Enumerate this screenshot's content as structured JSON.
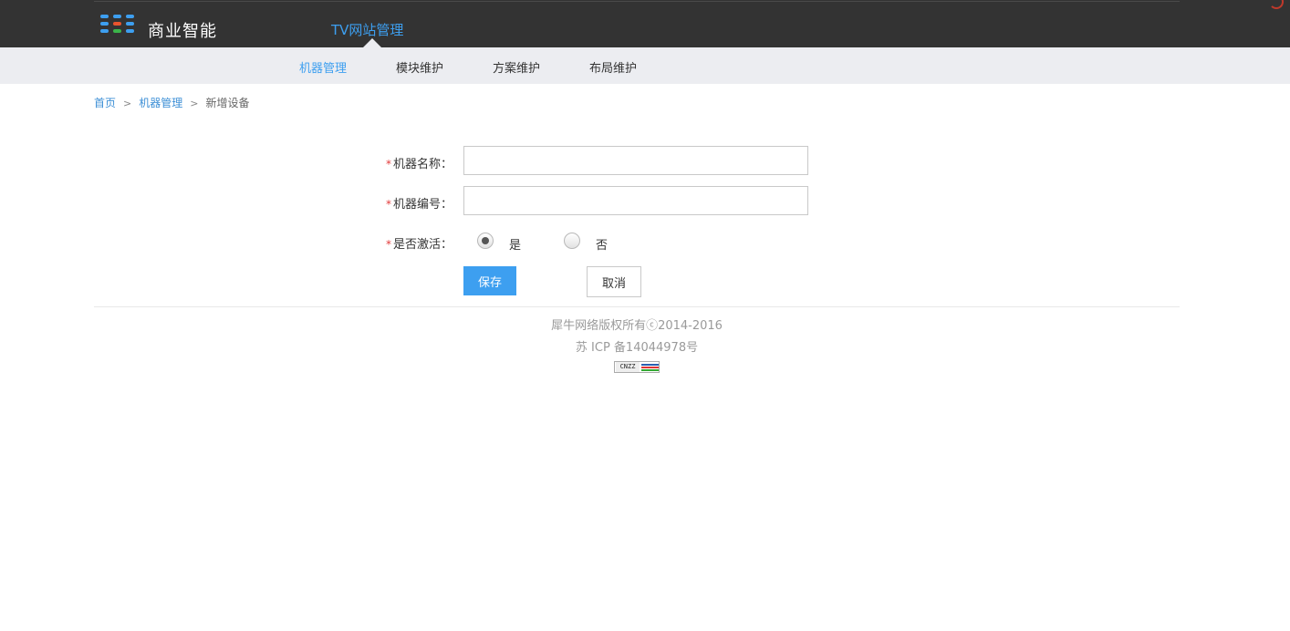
{
  "header": {
    "logo_text": "商业智能",
    "logo_colors": [
      "#3d9ff0",
      "#e8542e",
      "#3bb54a"
    ],
    "nav_title": "TV网站管理"
  },
  "subnav": {
    "items": [
      {
        "label": "机器管理",
        "active": true
      },
      {
        "label": "模块维护",
        "active": false
      },
      {
        "label": "方案维护",
        "active": false
      },
      {
        "label": "布局维护",
        "active": false
      }
    ]
  },
  "breadcrumb": {
    "home": "首页",
    "separator": ">",
    "parent": "机器管理",
    "current": "新增设备"
  },
  "form": {
    "required_mark": "*",
    "machine_name": {
      "label": "机器名称：",
      "value": "",
      "placeholder": ""
    },
    "machine_code": {
      "label": "机器编号：",
      "value": "",
      "placeholder": ""
    },
    "active": {
      "label": "是否激活：",
      "options": [
        {
          "label": "是",
          "checked": true
        },
        {
          "label": "否",
          "checked": false
        }
      ]
    },
    "save_label": "保存",
    "cancel_label": "取消"
  },
  "footer": {
    "copyright": "犀牛网络版权所有ⓒ2014-2016",
    "icp": "苏 ICP 备14044978号",
    "cnzz_text": "CNZZ"
  },
  "colors": {
    "accent": "#3d9ff0",
    "topbar": "#333333",
    "subnav_bg": "#ecedf1",
    "required": "#e23b3b"
  }
}
